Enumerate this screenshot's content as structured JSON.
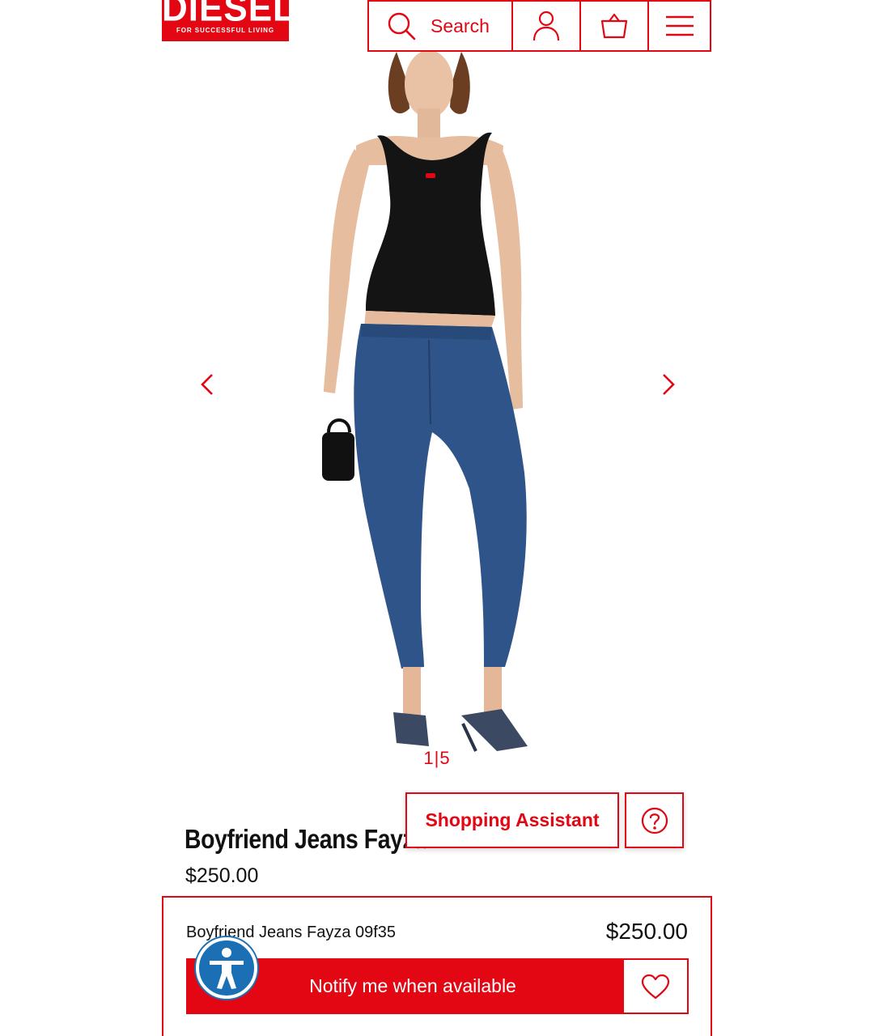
{
  "brand": {
    "logo_text": "DIESEL",
    "tagline": "FOR SUCCESSFUL LIVING",
    "accent_color": "#e30613"
  },
  "header": {
    "search_label": "Search",
    "icons": [
      "search-icon",
      "account-icon",
      "basket-icon",
      "menu-icon"
    ]
  },
  "gallery": {
    "current": "1",
    "separator": "|",
    "total": "5",
    "prev_icon": "chevron-left-icon",
    "next_icon": "chevron-right-icon"
  },
  "product": {
    "title": "Boyfriend Jeans Fayza",
    "price": "$250.00"
  },
  "assistant": {
    "label": "Shopping Assistant",
    "help_icon": "question-circle-icon"
  },
  "buy_box": {
    "name": "Boyfriend Jeans Fayza 09f35",
    "price": "$250.00",
    "notify_label": "Notify me when available",
    "wishlist_icon": "heart-icon"
  },
  "accessibility": {
    "icon": "accessibility-icon",
    "color": "#1a6fb5"
  }
}
